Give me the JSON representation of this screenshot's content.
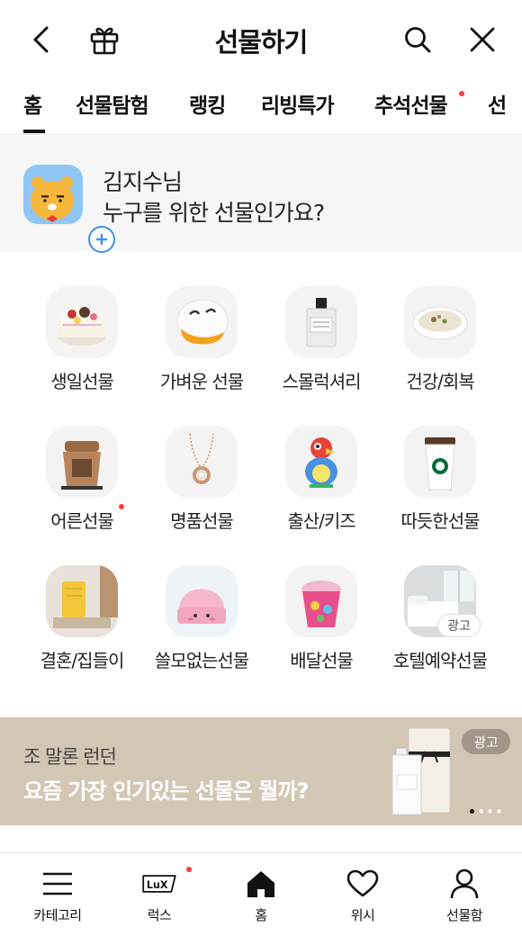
{
  "header": {
    "title": "선물하기"
  },
  "tabs": [
    {
      "label": "홈",
      "active": true
    },
    {
      "label": "선물탐험"
    },
    {
      "label": "랭킹"
    },
    {
      "label": "리빙특가"
    },
    {
      "label": "추석선물",
      "new_dot": true
    },
    {
      "label": "선"
    }
  ],
  "profile": {
    "name": "김지수님",
    "question": "누구를 위한 선물인가요?"
  },
  "categories": [
    {
      "label": "생일선물",
      "icon": "birthday-cake-icon"
    },
    {
      "label": "가벼운 선물",
      "icon": "duck-cushion-icon"
    },
    {
      "label": "스몰럭셔리",
      "icon": "perfume-icon"
    },
    {
      "label": "건강/회복",
      "icon": "porridge-icon"
    },
    {
      "label": "어른선물",
      "icon": "coffee-machine-icon",
      "new_dot": true
    },
    {
      "label": "명품선물",
      "icon": "necklace-icon"
    },
    {
      "label": "출산/키즈",
      "icon": "toy-parrot-icon"
    },
    {
      "label": "따듯한선물",
      "icon": "coffee-cup-icon"
    },
    {
      "label": "결혼/집들이",
      "icon": "lamp-icon"
    },
    {
      "label": "쓸모없는선물",
      "icon": "pink-beanie-icon"
    },
    {
      "label": "배달선물",
      "icon": "ice-cream-icon"
    },
    {
      "label": "호텔예약선물",
      "icon": "hotel-room-icon",
      "ad": "광고"
    }
  ],
  "banner": {
    "brand": "조 말론 런던",
    "headline": "요즘 가장 인기있는 선물은 뭘까?",
    "ad": "광고",
    "slides": 4,
    "active_slide": 1
  },
  "bottom_nav": [
    {
      "label": "카테고리",
      "icon": "menu-icon"
    },
    {
      "label": "럭스",
      "icon": "lux-icon",
      "new_dot": true
    },
    {
      "label": "홈",
      "icon": "home-icon",
      "active": true
    },
    {
      "label": "위시",
      "icon": "heart-icon"
    },
    {
      "label": "선물함",
      "icon": "person-icon"
    }
  ],
  "colors": {
    "accent_dot": "#ff3b3b",
    "profile_bg": "#f6f6f6",
    "banner_bg": "#d4c6b5"
  }
}
